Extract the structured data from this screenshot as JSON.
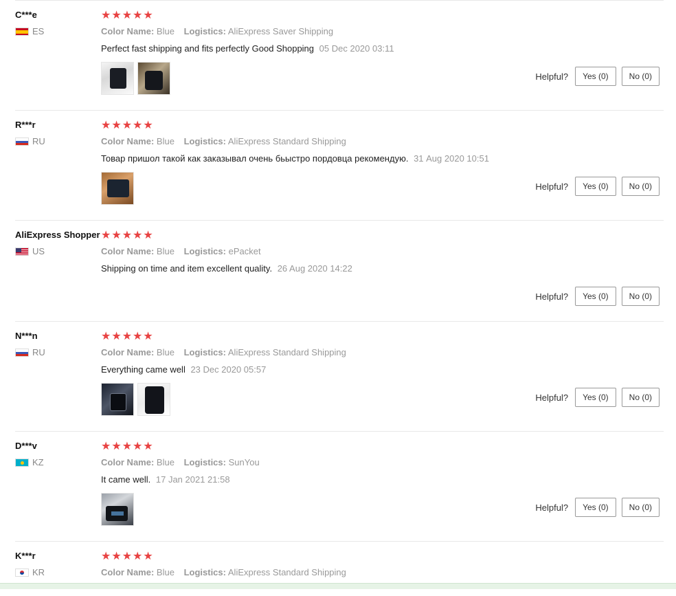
{
  "labels": {
    "color_name": "Color Name:",
    "logistics": "Logistics:",
    "helpful": "Helpful?"
  },
  "reviews": [
    {
      "user": "C***e",
      "country": "ES",
      "flag": "es",
      "stars": "★★★★★",
      "color": "Blue",
      "logistics": "AliExpress Saver Shipping",
      "text": "Perfect fast shipping and fits perfectly Good Shopping",
      "date": "05 Dec 2020 03:11",
      "yes": "Yes (0)",
      "no": "No (0)",
      "images": 2
    },
    {
      "user": "R***r",
      "country": "RU",
      "flag": "ru",
      "stars": "★★★★★",
      "color": "Blue",
      "logistics": "AliExpress Standard Shipping",
      "text": "Товар пришол такой как заказывал очень бьыстро пордовца рекомендую.",
      "date": "31 Aug 2020 10:51",
      "yes": "Yes (0)",
      "no": "No (0)",
      "images": 1
    },
    {
      "user": "AliExpress Shopper",
      "country": "US",
      "flag": "us",
      "stars": "★★★★★",
      "color": "Blue",
      "logistics": "ePacket",
      "text": "Shipping on time and item excellent quality.",
      "date": "26 Aug 2020 14:22",
      "yes": "Yes (0)",
      "no": "No (0)",
      "images": 0
    },
    {
      "user": "N***n",
      "country": "RU",
      "flag": "ru",
      "stars": "★★★★★",
      "color": "Blue",
      "logistics": "AliExpress Standard Shipping",
      "text": "Everything came well",
      "date": "23 Dec 2020 05:57",
      "yes": "Yes (0)",
      "no": "No (0)",
      "images": 2
    },
    {
      "user": "D***v",
      "country": "KZ",
      "flag": "kz",
      "stars": "★★★★★",
      "color": "Blue",
      "logistics": "SunYou",
      "text": "It came well.",
      "date": "17 Jan 2021 21:58",
      "yes": "Yes (0)",
      "no": "No (0)",
      "images": 1
    },
    {
      "user": "K***r",
      "country": "KR",
      "flag": "kr",
      "stars": "★★★★★",
      "color": "Blue",
      "logistics": "AliExpress Standard Shipping",
      "text": "",
      "date": "",
      "yes": "",
      "no": "",
      "images": 0
    }
  ],
  "colors": {
    "star": "#e84343",
    "muted": "#999999",
    "border": "#e8e8e8"
  }
}
